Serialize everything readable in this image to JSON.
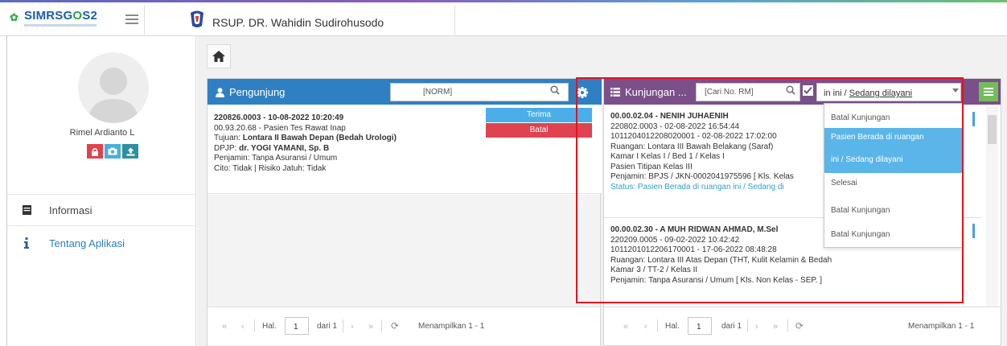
{
  "app": {
    "logo_text_a": "SIMRSG",
    "logo_text_o": "O",
    "logo_text_b": "S2",
    "hospital_name": "RSUP. DR. Wahidin Sudirohusodo"
  },
  "sidebar": {
    "user_name": "Rimel Ardianto L",
    "items": [
      {
        "label": "Informasi",
        "icon": "book-icon"
      },
      {
        "label": "Tentang Aplikasi",
        "icon": "info-icon"
      }
    ]
  },
  "pengunjung": {
    "title": "Pengunjung",
    "search_placeholder": "[NORM]",
    "card": {
      "line1": "220826.0003 - 10-08-2022 10:20:49",
      "line2": "00.93.20.68 - Pasien Tes Rawat Inap",
      "line3_label": "Tujuan: ",
      "line3_value": "Lontara II Bawah Depan (Bedah Urologi)",
      "line4_label": "DPJP: ",
      "line4_value": "dr. YOGI YAMANI, Sp. B",
      "line5": "Penjamin: Tanpa Asuransi / Umum",
      "line6": "Cito: Tidak | Risiko Jatuh: Tidak",
      "btn_terima": "Terima",
      "btn_batal": "Batal"
    },
    "pager": {
      "hal": "Hal.",
      "page": "1",
      "dari": "dari 1",
      "showing": "Menampilkan 1 - 1"
    }
  },
  "kunjungan": {
    "title": "Kunjungan ...",
    "search_placeholder": "[Cari No. RM]",
    "select_value_prefix": "in ini / ",
    "select_value_suffix": "Sedang dilayani",
    "cards": [
      {
        "line1": "00.00.02.04 - NENIH JUHAENIH",
        "line2": "220802.0003 - 02-08-2022 16:54:44",
        "line3": "1011204012208020001 - 02-08-2022 17:02:00",
        "line4": "Ruangan: Lontara III Bawah Belakang (Saraf)",
        "line5": "Kamar I Kelas I / Bed 1 / Kelas I",
        "line6": "Pasien Titipan Kelas III",
        "line7": "Penjamin: BPJS / JKN-0002041975596 [ Kls. Kelas",
        "status": "Status: Pasien Berada di ruangan ini / Sedang di"
      },
      {
        "line1": "00.00.02.30 - A MUH RIDWAN AHMAD, M.Sel",
        "line2": "220209.0005 - 09-02-2022 10:42:42",
        "line3": "1011201012206170001 - 17-06-2022 08:48:28",
        "line4": "Ruangan: Lontara III Atas Depan (THT, Kulit Kelamin & Bedah",
        "line5": "Kamar 3 / TT-2 / Kelas II",
        "line6": "Penjamin: Tanpa Asuransi / Umum [ Kls. Non Kelas - SEP. ]"
      }
    ],
    "dropdown": [
      "Batal Kunjungan",
      "Pasien Berada di ruangan",
      "ini / Sedang dilayani",
      "Selesai",
      "Batal Kunjungan",
      "Batal Kunjungan"
    ],
    "pager": {
      "hal": "Hal.",
      "page": "1",
      "dari": "dari 1",
      "showing": "Menampilkan 1 - 1"
    }
  },
  "colors": {
    "pengunjung_header": "#2f80c2",
    "kunjungan_header": "#7a4f8a",
    "terima": "#4aaee8",
    "batal": "#e04350",
    "dropdown_selected": "#5ab5e8",
    "annotation": "#e0141e"
  }
}
